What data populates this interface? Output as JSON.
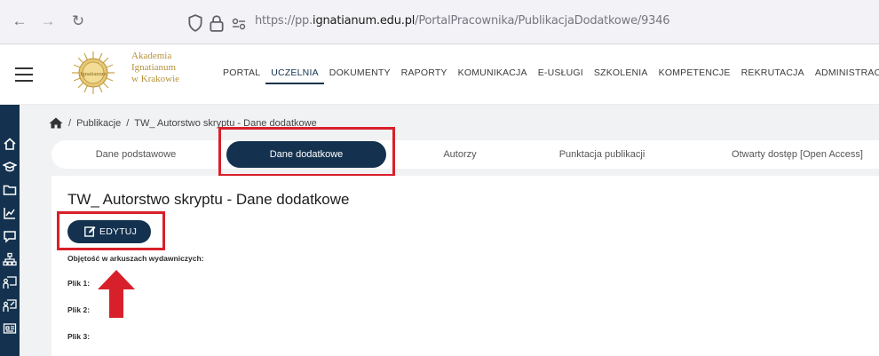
{
  "browser": {
    "back": "←",
    "forward": "→",
    "reload": "↻",
    "url_prefix": "https://pp.",
    "url_domain": "ignatianum.edu.pl",
    "url_path": "/PortalPracownika/PublikacjaDodatkowe/9346"
  },
  "logo": {
    "line1": "Akademia",
    "line2": "Ignatianum",
    "line3": "w Krakowie",
    "seal_text": "Ignatianum"
  },
  "menu": [
    "PORTAL",
    "UCZELNIA",
    "DOKUMENTY",
    "RAPORTY",
    "KOMUNIKACJA",
    "E-USŁUGI",
    "SZKOLENIA",
    "KOMPETENCJE",
    "REKRUTACJA",
    "ADMINISTRACJA"
  ],
  "menu_active": "UCZELNIA",
  "breadcrumb": {
    "sep": "/",
    "item1": "Publikacje",
    "item2": "TW_ Autorstwo skryptu - Dane dodatkowe"
  },
  "tabs": {
    "t1": "Dane podstawowe",
    "t2": "Dane dodatkowe",
    "t3": "Autorzy",
    "t4": "Punktacja publikacji",
    "t5": "Otwarty dostęp [Open Access]"
  },
  "page": {
    "title": "TW_ Autorstwo skryptu - Dane dodatkowe",
    "edit_label": "EDYTUJ",
    "volume_label": "Objętość w arkuszach wydawniczych:",
    "file1": "Plik 1:",
    "file2": "Plik 2:",
    "file3": "Plik 3:"
  },
  "colors": {
    "primary": "#14324f",
    "annotation": "#d8202a",
    "gold": "#b7923a"
  }
}
